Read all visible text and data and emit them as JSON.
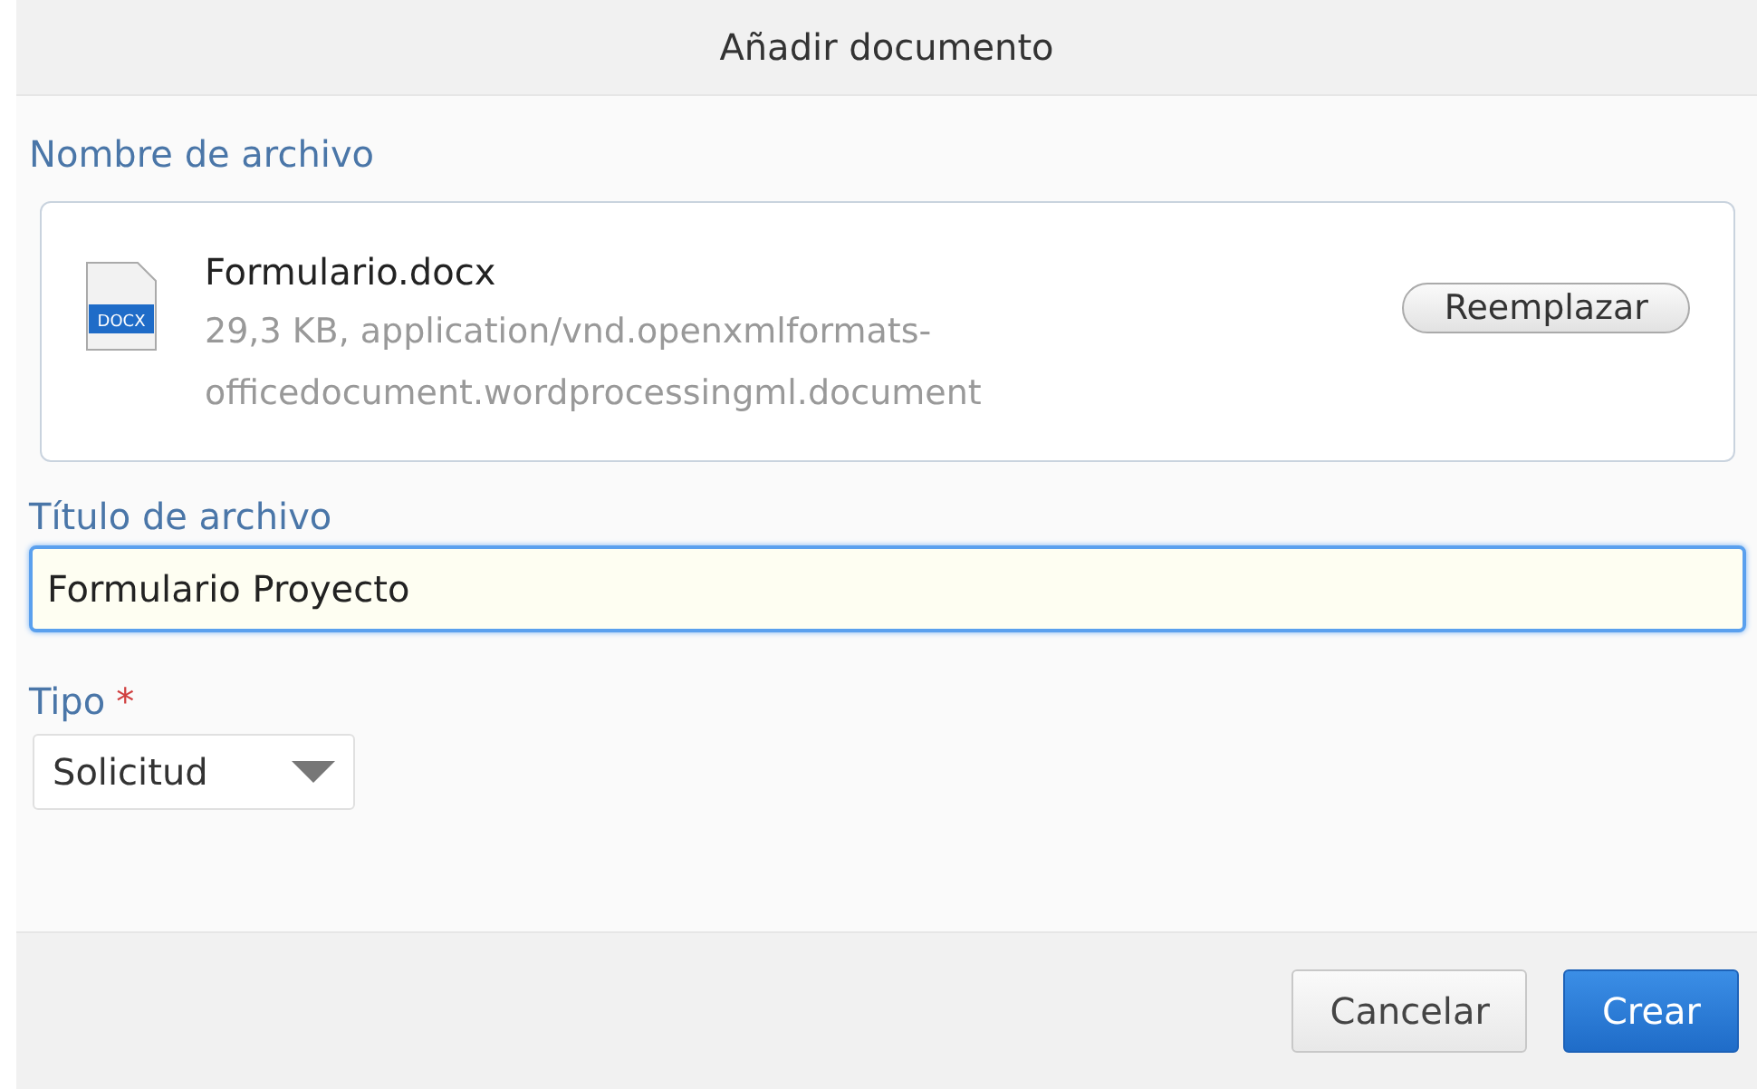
{
  "dialog": {
    "title": "Añadir documento"
  },
  "file_section": {
    "label": "Nombre de archivo",
    "file_name": "Formulario.docx",
    "file_badge": "DOCX",
    "description": "29,3 KB, application/vnd.openxmlformats-officedocument.wordprocessingml.document",
    "replace_button": "Reemplazar"
  },
  "title_field": {
    "label": "Título de archivo",
    "value": "Formulario Proyecto",
    "focused": true
  },
  "type_field": {
    "label": "Tipo",
    "required_mark": "*",
    "value": "Solicitud"
  },
  "buttons": [
    {
      "label": "Cancelar",
      "kind": "secondary"
    },
    {
      "label": "Crear",
      "kind": "primary"
    }
  ]
}
